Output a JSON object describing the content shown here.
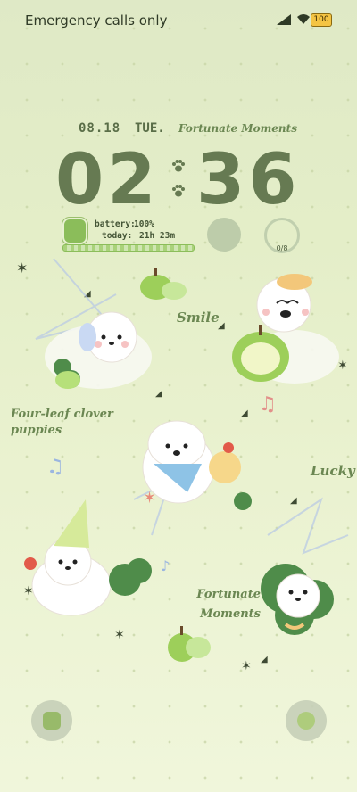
{
  "status_bar": {
    "carrier_text": "Emergency calls only",
    "battery_level": "100",
    "icons": [
      "signal-icon",
      "wifi-icon",
      "battery-icon"
    ]
  },
  "lockscreen": {
    "date": "08.18",
    "weekday": "TUE.",
    "tagline": "Fortunate Moments",
    "time_hours": "02",
    "time_minutes": "36",
    "battery_label": "battery:",
    "battery_value": "100%",
    "today_label": "today:",
    "today_value": "21h 23m",
    "steps_widget_text": "0/8"
  },
  "stickers": {
    "smile": "Smile",
    "clover_puppies": "Four-leaf clover puppies",
    "lucky": "Lucky",
    "fortunate": "Fortunate Moments"
  },
  "colors": {
    "accent": "#667a52",
    "background": "#e4eec8",
    "apple_green": "#9dcf5a",
    "clover": "#4f8c4a",
    "battery_yellow": "#f4c443"
  },
  "shortcuts": {
    "left_icon": "phone-icon",
    "right_icon": "camera-icon"
  }
}
